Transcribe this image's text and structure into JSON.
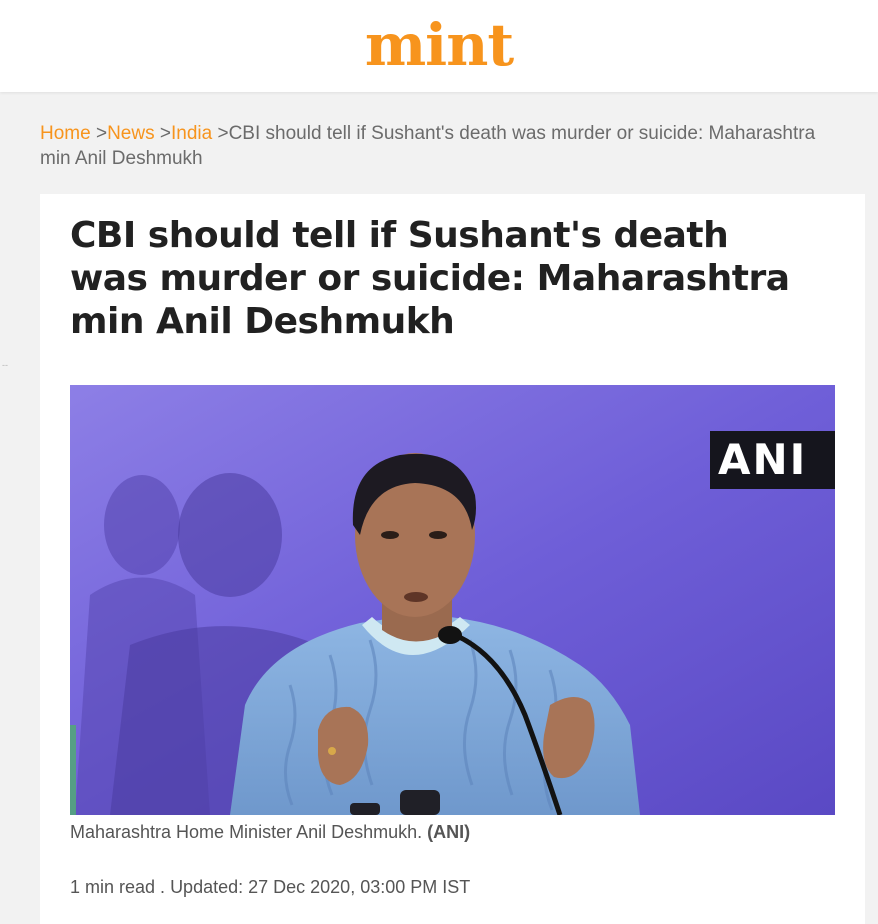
{
  "header": {
    "logo_text": "mint",
    "logo_color": "#f7941d"
  },
  "breadcrumb": {
    "items": [
      {
        "label": "Home"
      },
      {
        "label": "News"
      },
      {
        "label": "India"
      }
    ],
    "separator": ">",
    "current": "CBI should tell if Sushant's death was murder or suicide: Maharashtra min Anil Deshmukh"
  },
  "article": {
    "headline": "CBI should tell if Sushant's death was murder or suicide: Maharashtra min Anil Deshmukh",
    "image": {
      "watermark": "ANI",
      "caption": "Maharashtra Home Minister Anil Deshmukh.",
      "credit": "(ANI)"
    },
    "meta": {
      "read_time": "1 min read",
      "separator": " . ",
      "updated": "Updated: 27 Dec 2020, 03:00 PM IST"
    }
  },
  "side_mark": "--"
}
